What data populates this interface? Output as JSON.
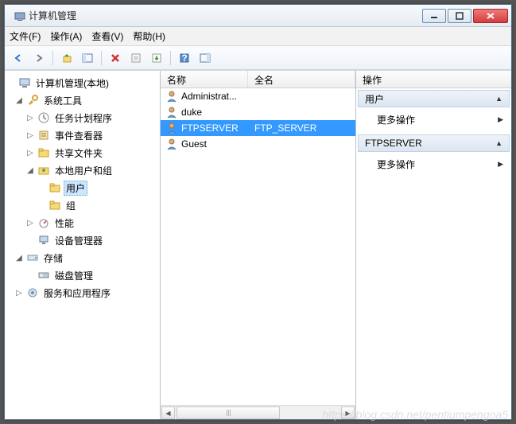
{
  "window": {
    "title": "计算机管理"
  },
  "menu": {
    "file": "文件(F)",
    "action": "操作(A)",
    "view": "查看(V)",
    "help": "帮助(H)"
  },
  "tree": {
    "root": "计算机管理(本地)",
    "system_tools": "系统工具",
    "task_scheduler": "任务计划程序",
    "event_viewer": "事件查看器",
    "shared_folders": "共享文件夹",
    "local_users_groups": "本地用户和组",
    "users": "用户",
    "groups": "组",
    "performance": "性能",
    "device_manager": "设备管理器",
    "storage": "存储",
    "disk_management": "磁盘管理",
    "services_apps": "服务和应用程序"
  },
  "list": {
    "col_name": "名称",
    "col_fullname": "全名",
    "rows": [
      {
        "name": "Administrat...",
        "full": "",
        "sel": false
      },
      {
        "name": "duke",
        "full": "",
        "sel": false
      },
      {
        "name": "FTPSERVER",
        "full": "FTP_SERVER",
        "sel": true
      },
      {
        "name": "Guest",
        "full": "",
        "sel": false
      }
    ]
  },
  "actions": {
    "title": "操作",
    "sections": [
      {
        "header": "用户",
        "items": [
          "更多操作"
        ]
      },
      {
        "header": "FTPSERVER",
        "items": [
          "更多操作"
        ]
      }
    ]
  },
  "watermark": "https://blog.csdn.net/pentiumpengoa5"
}
